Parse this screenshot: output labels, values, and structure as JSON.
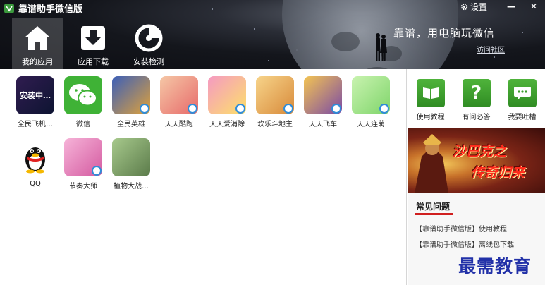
{
  "window": {
    "title": "靠谱助手微信版",
    "settings_label": "设置",
    "minimize_glyph": "—",
    "close_glyph": "✕"
  },
  "tabs": [
    {
      "label": "我的应用",
      "icon": "home-icon",
      "active": true
    },
    {
      "label": "应用下载",
      "icon": "download-icon",
      "active": false
    },
    {
      "label": "安装检测",
      "icon": "scan-icon",
      "active": false
    }
  ],
  "banner_header": {
    "slogan": "靠谱，用电脑玩微信",
    "community_link": "访问社区"
  },
  "apps": [
    {
      "name": "全民飞机…",
      "icon": "plane-game-icon",
      "status": "安装中…"
    },
    {
      "name": "微信",
      "icon": "wechat-icon"
    },
    {
      "name": "全民英雄",
      "icon": "hero-game-icon"
    },
    {
      "name": "天天酷跑",
      "icon": "parkour-game-icon"
    },
    {
      "name": "天天爱消除",
      "icon": "match-game-icon"
    },
    {
      "name": "欢乐斗地主",
      "icon": "landlord-game-icon"
    },
    {
      "name": "天天飞车",
      "icon": "racing-game-icon"
    },
    {
      "name": "天天连萌",
      "icon": "link-game-icon"
    },
    {
      "name": "QQ",
      "icon": "qq-penguin-icon"
    },
    {
      "name": "节奏大师",
      "icon": "rhythm-game-icon"
    },
    {
      "name": "植物大战…",
      "icon": "plants-zombies-icon"
    }
  ],
  "help": [
    {
      "label": "使用教程",
      "icon": "book-icon"
    },
    {
      "label": "有问必答",
      "icon": "question-icon"
    },
    {
      "label": "我要吐槽",
      "icon": "chat-bubble-icon"
    }
  ],
  "promo": {
    "line1": "沙巴克之",
    "line2": "传奇归来"
  },
  "faq": {
    "title": "常见问题",
    "links": [
      "【靠谱助手微信版】使用教程",
      "【靠谱助手微信版】离线包下载"
    ]
  },
  "watermark": "最需教育",
  "colors": {
    "header_bg": "#14161c",
    "help_green": "#3a9e2c",
    "faq_accent": "#d01f1f",
    "watermark": "#2231a8"
  }
}
